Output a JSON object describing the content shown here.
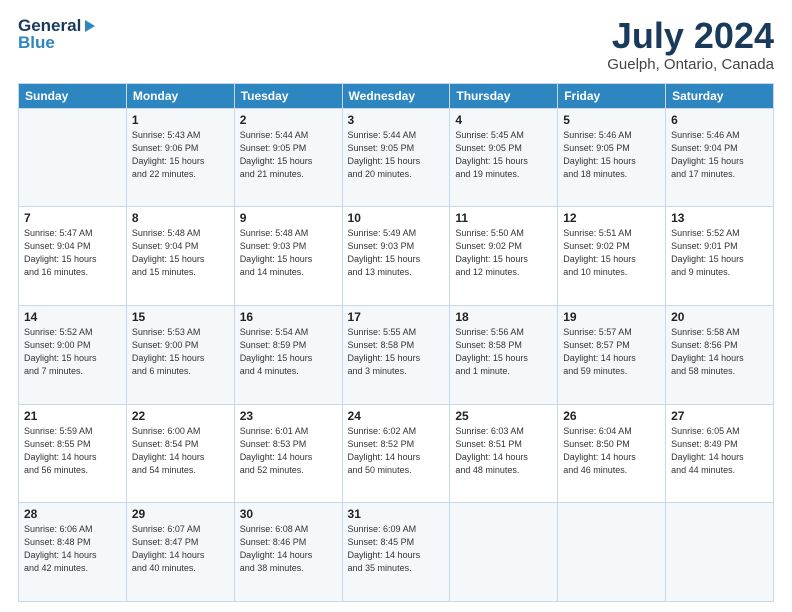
{
  "header": {
    "logo_line1": "General",
    "logo_line2": "Blue",
    "title": "July 2024",
    "subtitle": "Guelph, Ontario, Canada"
  },
  "days_of_week": [
    "Sunday",
    "Monday",
    "Tuesday",
    "Wednesday",
    "Thursday",
    "Friday",
    "Saturday"
  ],
  "weeks": [
    [
      {
        "num": "",
        "info": ""
      },
      {
        "num": "1",
        "info": "Sunrise: 5:43 AM\nSunset: 9:06 PM\nDaylight: 15 hours\nand 22 minutes."
      },
      {
        "num": "2",
        "info": "Sunrise: 5:44 AM\nSunset: 9:05 PM\nDaylight: 15 hours\nand 21 minutes."
      },
      {
        "num": "3",
        "info": "Sunrise: 5:44 AM\nSunset: 9:05 PM\nDaylight: 15 hours\nand 20 minutes."
      },
      {
        "num": "4",
        "info": "Sunrise: 5:45 AM\nSunset: 9:05 PM\nDaylight: 15 hours\nand 19 minutes."
      },
      {
        "num": "5",
        "info": "Sunrise: 5:46 AM\nSunset: 9:05 PM\nDaylight: 15 hours\nand 18 minutes."
      },
      {
        "num": "6",
        "info": "Sunrise: 5:46 AM\nSunset: 9:04 PM\nDaylight: 15 hours\nand 17 minutes."
      }
    ],
    [
      {
        "num": "7",
        "info": "Sunrise: 5:47 AM\nSunset: 9:04 PM\nDaylight: 15 hours\nand 16 minutes."
      },
      {
        "num": "8",
        "info": "Sunrise: 5:48 AM\nSunset: 9:04 PM\nDaylight: 15 hours\nand 15 minutes."
      },
      {
        "num": "9",
        "info": "Sunrise: 5:48 AM\nSunset: 9:03 PM\nDaylight: 15 hours\nand 14 minutes."
      },
      {
        "num": "10",
        "info": "Sunrise: 5:49 AM\nSunset: 9:03 PM\nDaylight: 15 hours\nand 13 minutes."
      },
      {
        "num": "11",
        "info": "Sunrise: 5:50 AM\nSunset: 9:02 PM\nDaylight: 15 hours\nand 12 minutes."
      },
      {
        "num": "12",
        "info": "Sunrise: 5:51 AM\nSunset: 9:02 PM\nDaylight: 15 hours\nand 10 minutes."
      },
      {
        "num": "13",
        "info": "Sunrise: 5:52 AM\nSunset: 9:01 PM\nDaylight: 15 hours\nand 9 minutes."
      }
    ],
    [
      {
        "num": "14",
        "info": "Sunrise: 5:52 AM\nSunset: 9:00 PM\nDaylight: 15 hours\nand 7 minutes."
      },
      {
        "num": "15",
        "info": "Sunrise: 5:53 AM\nSunset: 9:00 PM\nDaylight: 15 hours\nand 6 minutes."
      },
      {
        "num": "16",
        "info": "Sunrise: 5:54 AM\nSunset: 8:59 PM\nDaylight: 15 hours\nand 4 minutes."
      },
      {
        "num": "17",
        "info": "Sunrise: 5:55 AM\nSunset: 8:58 PM\nDaylight: 15 hours\nand 3 minutes."
      },
      {
        "num": "18",
        "info": "Sunrise: 5:56 AM\nSunset: 8:58 PM\nDaylight: 15 hours\nand 1 minute."
      },
      {
        "num": "19",
        "info": "Sunrise: 5:57 AM\nSunset: 8:57 PM\nDaylight: 14 hours\nand 59 minutes."
      },
      {
        "num": "20",
        "info": "Sunrise: 5:58 AM\nSunset: 8:56 PM\nDaylight: 14 hours\nand 58 minutes."
      }
    ],
    [
      {
        "num": "21",
        "info": "Sunrise: 5:59 AM\nSunset: 8:55 PM\nDaylight: 14 hours\nand 56 minutes."
      },
      {
        "num": "22",
        "info": "Sunrise: 6:00 AM\nSunset: 8:54 PM\nDaylight: 14 hours\nand 54 minutes."
      },
      {
        "num": "23",
        "info": "Sunrise: 6:01 AM\nSunset: 8:53 PM\nDaylight: 14 hours\nand 52 minutes."
      },
      {
        "num": "24",
        "info": "Sunrise: 6:02 AM\nSunset: 8:52 PM\nDaylight: 14 hours\nand 50 minutes."
      },
      {
        "num": "25",
        "info": "Sunrise: 6:03 AM\nSunset: 8:51 PM\nDaylight: 14 hours\nand 48 minutes."
      },
      {
        "num": "26",
        "info": "Sunrise: 6:04 AM\nSunset: 8:50 PM\nDaylight: 14 hours\nand 46 minutes."
      },
      {
        "num": "27",
        "info": "Sunrise: 6:05 AM\nSunset: 8:49 PM\nDaylight: 14 hours\nand 44 minutes."
      }
    ],
    [
      {
        "num": "28",
        "info": "Sunrise: 6:06 AM\nSunset: 8:48 PM\nDaylight: 14 hours\nand 42 minutes."
      },
      {
        "num": "29",
        "info": "Sunrise: 6:07 AM\nSunset: 8:47 PM\nDaylight: 14 hours\nand 40 minutes."
      },
      {
        "num": "30",
        "info": "Sunrise: 6:08 AM\nSunset: 8:46 PM\nDaylight: 14 hours\nand 38 minutes."
      },
      {
        "num": "31",
        "info": "Sunrise: 6:09 AM\nSunset: 8:45 PM\nDaylight: 14 hours\nand 35 minutes."
      },
      {
        "num": "",
        "info": ""
      },
      {
        "num": "",
        "info": ""
      },
      {
        "num": "",
        "info": ""
      }
    ]
  ]
}
